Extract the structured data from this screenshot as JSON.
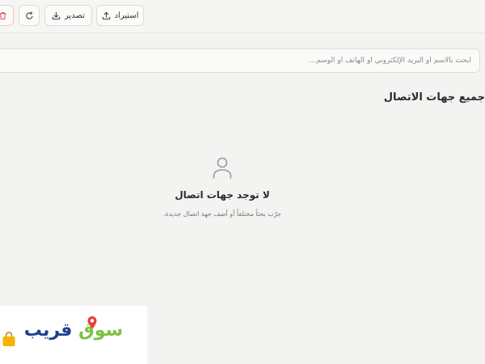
{
  "toolbar": {
    "import_label": "استيراد",
    "export_label": "تصدير",
    "refresh_icon": "refresh-icon",
    "delete_icon": "trash-icon"
  },
  "search": {
    "placeholder": "ابحث بالاسم أو البريد الإلكتروني أو الهاتف أو الوسم..."
  },
  "main": {
    "section_title": "جميع جهات الاتصال"
  },
  "empty_state": {
    "icon": "user-icon",
    "title": "لا توجد جهات اتصال",
    "description": "جرّب بحثاً مختلفاً أو أضف جهة اتصال جديدة."
  },
  "watermark": {
    "part_1": "سوق",
    "part_2": "قريب"
  },
  "colors": {
    "delete_accent": "#e25555",
    "watermark_green": "#7cc241",
    "watermark_blue": "#1f3f8f",
    "watermark_pin": "#e8413b",
    "watermark_bag": "#f4b400"
  }
}
